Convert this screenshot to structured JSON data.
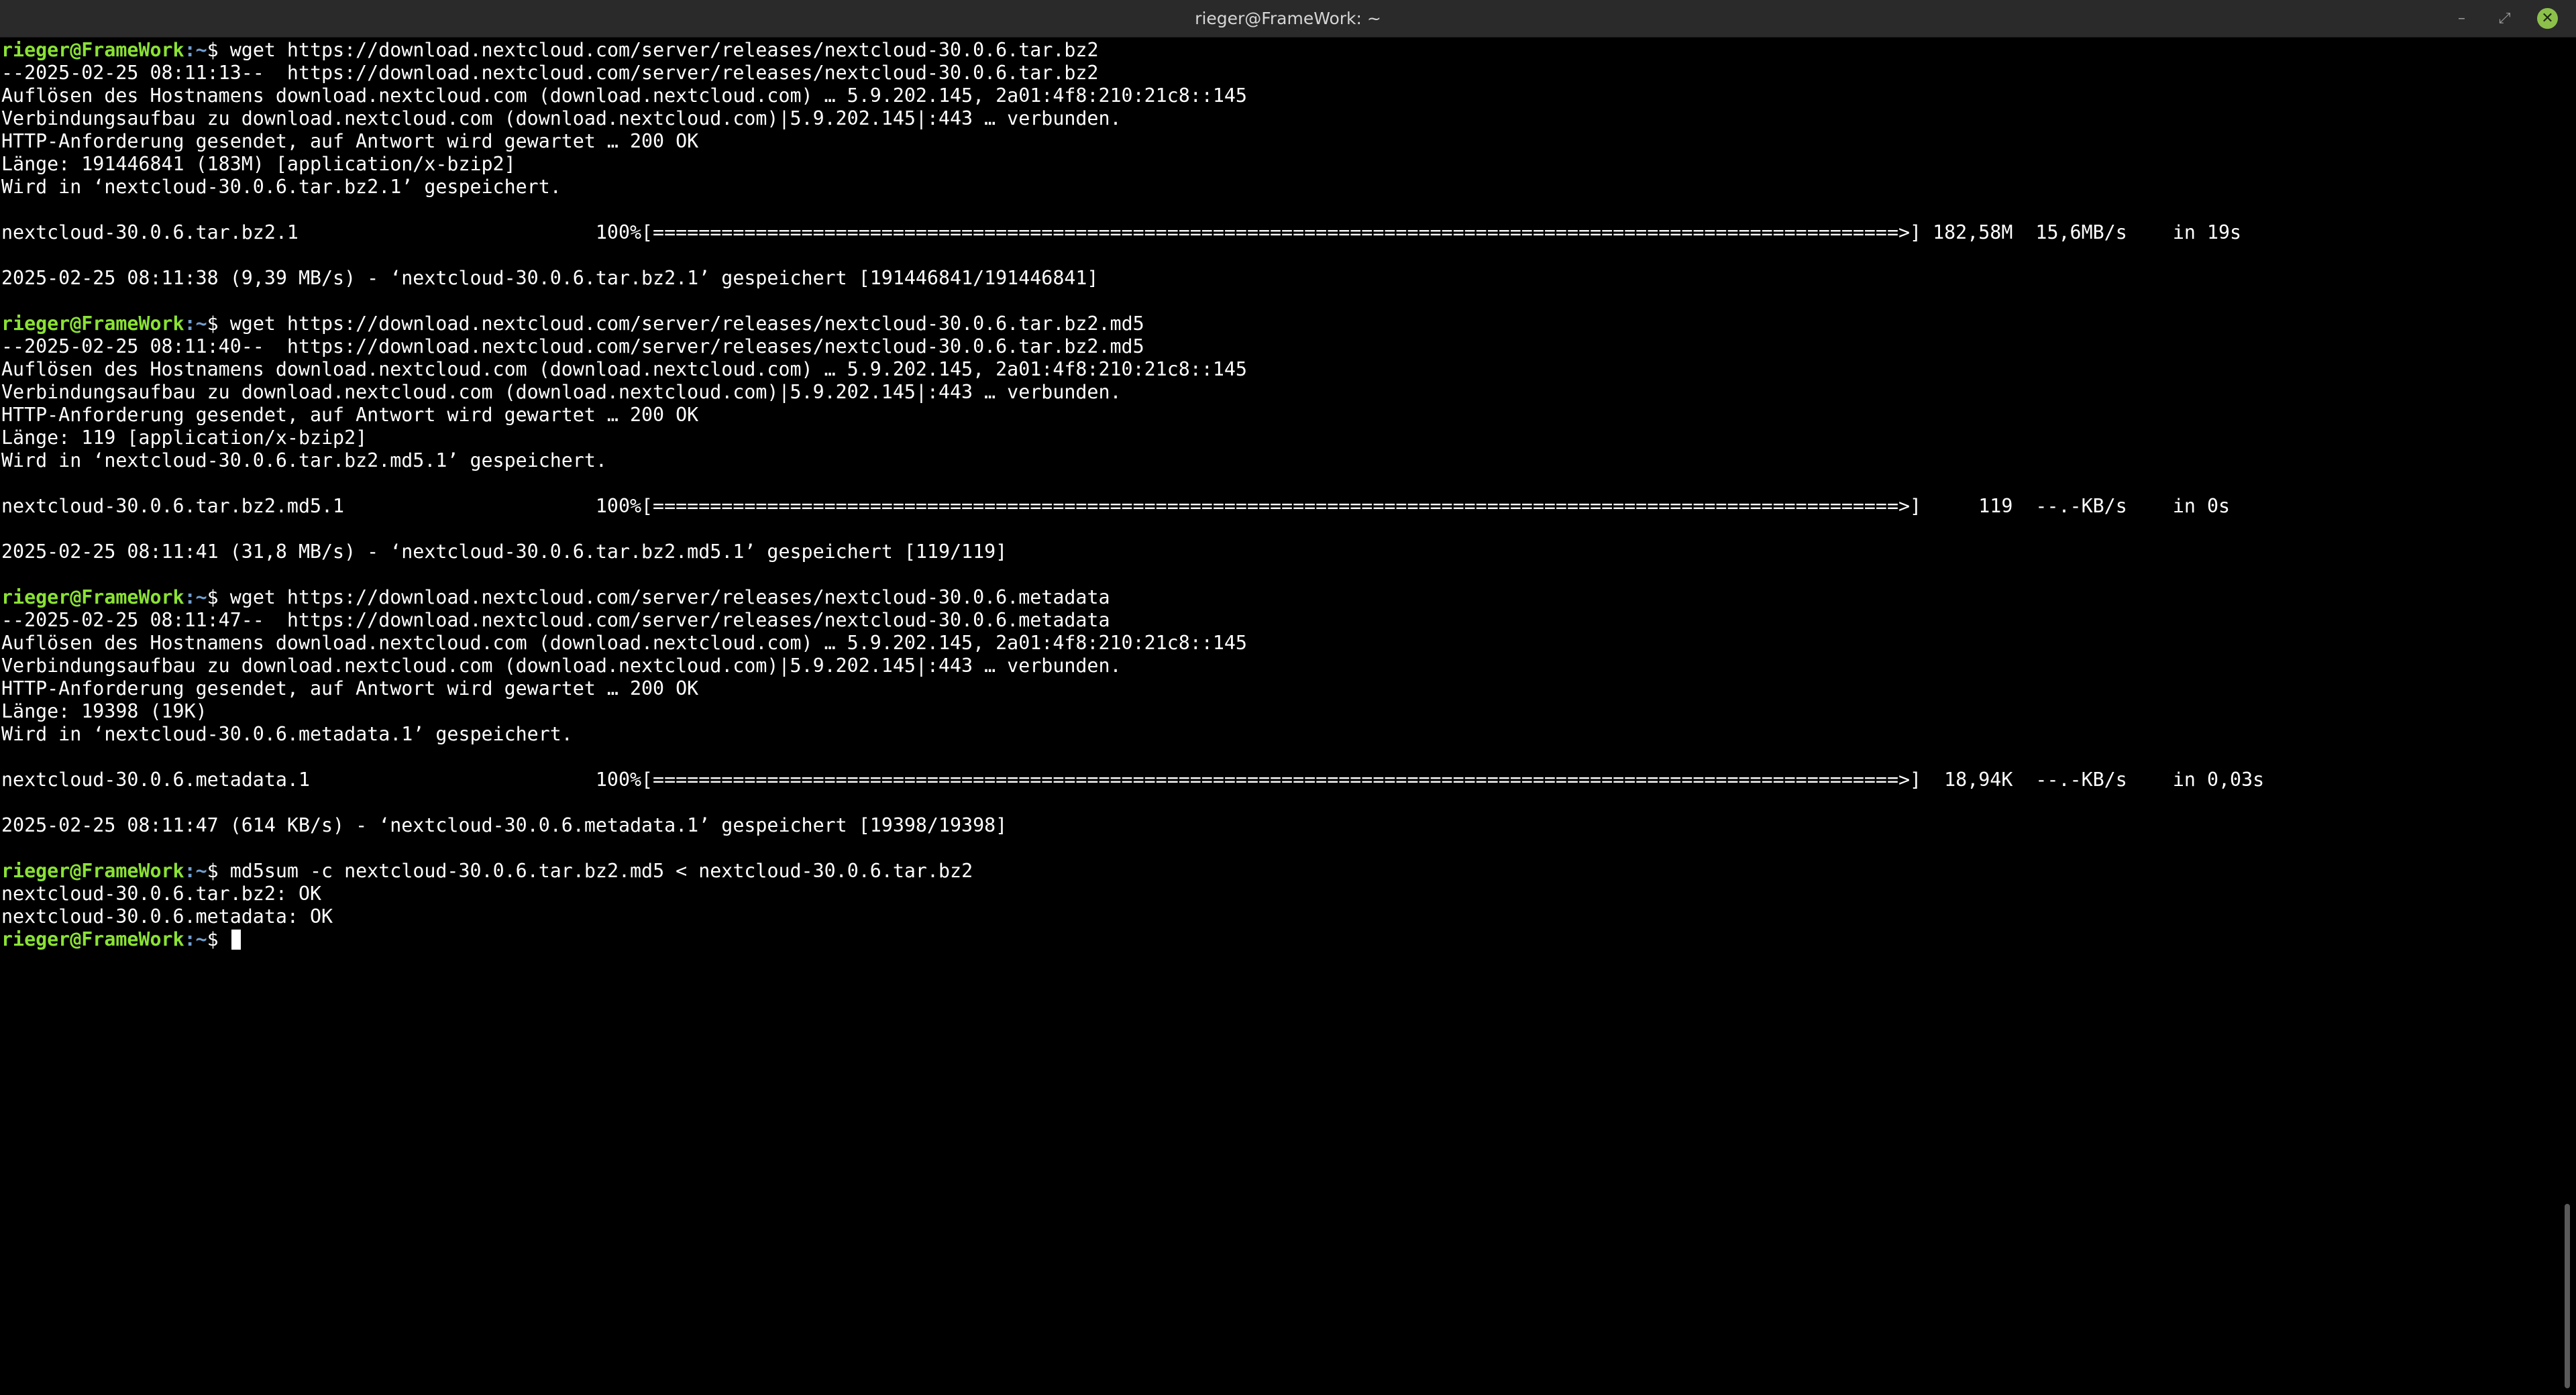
{
  "window": {
    "title": "rieger@FrameWork: ~",
    "minimize_glyph": "–",
    "maximize_glyph": "⤢",
    "close_glyph": "✕"
  },
  "prompt": {
    "user_host": "rieger@FrameWork",
    "path": ":~",
    "symbol": "$ "
  },
  "lines": [
    {
      "prompt": true,
      "text": "wget https://download.nextcloud.com/server/releases/nextcloud-30.0.6.tar.bz2"
    },
    {
      "text": "--2025-02-25 08:11:13--  https://download.nextcloud.com/server/releases/nextcloud-30.0.6.tar.bz2"
    },
    {
      "text": "Auflösen des Hostnamens download.nextcloud.com (download.nextcloud.com) … 5.9.202.145, 2a01:4f8:210:21c8::145"
    },
    {
      "text": "Verbindungsaufbau zu download.nextcloud.com (download.nextcloud.com)|5.9.202.145|:443 … verbunden."
    },
    {
      "text": "HTTP-Anforderung gesendet, auf Antwort wird gewartet … 200 OK"
    },
    {
      "text": "Länge: 191446841 (183M) [application/x-bzip2]"
    },
    {
      "text": "Wird in ‘nextcloud-30.0.6.tar.bz2.1’ gespeichert."
    },
    {
      "text": ""
    },
    {
      "text": "nextcloud-30.0.6.tar.bz2.1                          100%[=============================================================================================================>] 182,58M  15,6MB/s    in 19s"
    },
    {
      "text": ""
    },
    {
      "text": "2025-02-25 08:11:38 (9,39 MB/s) - ‘nextcloud-30.0.6.tar.bz2.1’ gespeichert [191446841/191446841]"
    },
    {
      "text": ""
    },
    {
      "prompt": true,
      "text": "wget https://download.nextcloud.com/server/releases/nextcloud-30.0.6.tar.bz2.md5"
    },
    {
      "text": "--2025-02-25 08:11:40--  https://download.nextcloud.com/server/releases/nextcloud-30.0.6.tar.bz2.md5"
    },
    {
      "text": "Auflösen des Hostnamens download.nextcloud.com (download.nextcloud.com) … 5.9.202.145, 2a01:4f8:210:21c8::145"
    },
    {
      "text": "Verbindungsaufbau zu download.nextcloud.com (download.nextcloud.com)|5.9.202.145|:443 … verbunden."
    },
    {
      "text": "HTTP-Anforderung gesendet, auf Antwort wird gewartet … 200 OK"
    },
    {
      "text": "Länge: 119 [application/x-bzip2]"
    },
    {
      "text": "Wird in ‘nextcloud-30.0.6.tar.bz2.md5.1’ gespeichert."
    },
    {
      "text": ""
    },
    {
      "text": "nextcloud-30.0.6.tar.bz2.md5.1                      100%[=============================================================================================================>]     119  --.-KB/s    in 0s"
    },
    {
      "text": ""
    },
    {
      "text": "2025-02-25 08:11:41 (31,8 MB/s) - ‘nextcloud-30.0.6.tar.bz2.md5.1’ gespeichert [119/119]"
    },
    {
      "text": ""
    },
    {
      "prompt": true,
      "text": "wget https://download.nextcloud.com/server/releases/nextcloud-30.0.6.metadata"
    },
    {
      "text": "--2025-02-25 08:11:47--  https://download.nextcloud.com/server/releases/nextcloud-30.0.6.metadata"
    },
    {
      "text": "Auflösen des Hostnamens download.nextcloud.com (download.nextcloud.com) … 5.9.202.145, 2a01:4f8:210:21c8::145"
    },
    {
      "text": "Verbindungsaufbau zu download.nextcloud.com (download.nextcloud.com)|5.9.202.145|:443 … verbunden."
    },
    {
      "text": "HTTP-Anforderung gesendet, auf Antwort wird gewartet … 200 OK"
    },
    {
      "text": "Länge: 19398 (19K)"
    },
    {
      "text": "Wird in ‘nextcloud-30.0.6.metadata.1’ gespeichert."
    },
    {
      "text": ""
    },
    {
      "text": "nextcloud-30.0.6.metadata.1                         100%[=============================================================================================================>]  18,94K  --.-KB/s    in 0,03s"
    },
    {
      "text": ""
    },
    {
      "text": "2025-02-25 08:11:47 (614 KB/s) - ‘nextcloud-30.0.6.metadata.1’ gespeichert [19398/19398]"
    },
    {
      "text": ""
    },
    {
      "prompt": true,
      "text": "md5sum -c nextcloud-30.0.6.tar.bz2.md5 < nextcloud-30.0.6.tar.bz2"
    },
    {
      "text": "nextcloud-30.0.6.tar.bz2: OK"
    },
    {
      "text": "nextcloud-30.0.6.metadata: OK"
    },
    {
      "prompt": true,
      "text": "",
      "cursor": true
    }
  ],
  "colors": {
    "background": "#000000",
    "foreground": "#ffffff",
    "prompt_user": "#8ae234",
    "prompt_path": "#729fcf",
    "titlebar": "#2a2a2a",
    "close_button": "#8cc04b"
  },
  "scrollbar": {
    "thumb_fraction": 0.136,
    "position": "bottom"
  }
}
